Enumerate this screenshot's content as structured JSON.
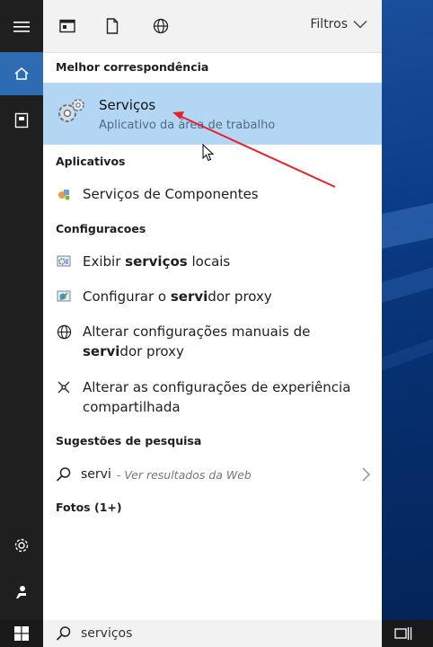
{
  "toolbar": {
    "filters_label": "Filtros"
  },
  "best_match": {
    "heading": "Melhor correspondência",
    "title": "Serviços",
    "subtitle": "Aplicativo da área de trabalho"
  },
  "apps": {
    "heading": "Aplicativos",
    "items": [
      {
        "label": "Serviços de Componentes"
      }
    ]
  },
  "settings": {
    "heading": "Configuracoes",
    "items": [
      {
        "pre": "Exibir ",
        "bold": "serviços",
        "post": " locais"
      },
      {
        "pre": "Configurar o ",
        "bold": "servi",
        "post": "dor proxy"
      },
      {
        "pre": "Alterar configurações manuais de ",
        "bold": "servi",
        "post": "dor proxy"
      },
      {
        "pre": "Alterar as configurações de experiência compartilhada",
        "bold": "",
        "post": ""
      }
    ]
  },
  "suggestions": {
    "heading": "Sugestões de pesquisa",
    "query": "servi",
    "hint": "- Ver resultados da Web"
  },
  "photos": {
    "heading": "Fotos (1+)"
  },
  "search": {
    "value": "serviços"
  },
  "colors": {
    "highlight": "#b4d6f5",
    "rail": "#1f1f1f",
    "accent": "#2d6bb3",
    "annotation": "#e8202a"
  }
}
